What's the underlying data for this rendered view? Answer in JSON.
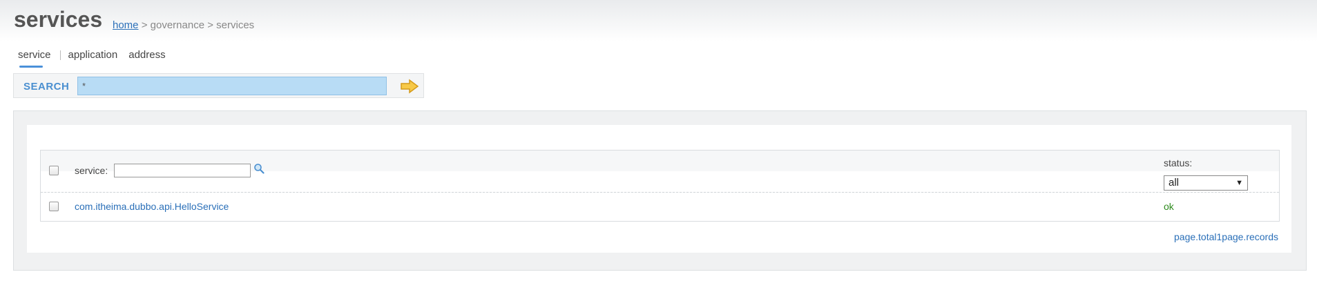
{
  "header": {
    "title": "services",
    "breadcrumb": {
      "home": "home",
      "sep1": " > ",
      "governance": "governance",
      "sep2": " > ",
      "current": "services"
    }
  },
  "tabs": [
    {
      "label": "service",
      "active": true
    },
    {
      "label": "application",
      "active": false
    },
    {
      "label": "address",
      "active": false
    }
  ],
  "search": {
    "label": "SEARCH",
    "value": "*",
    "go_icon": "arrow-right-icon"
  },
  "table": {
    "columns": {
      "service_label": "service:",
      "status_label": "status:"
    },
    "service_filter": {
      "value": "",
      "icon": "magnifier-icon"
    },
    "status_select": {
      "selected": "all"
    },
    "rows": [
      {
        "service": "com.itheima.dubbo.api.HelloService",
        "status": "ok"
      }
    ]
  },
  "paging": {
    "text": "page.total1page.records"
  },
  "colors": {
    "accent": "#4a8fd0",
    "link": "#2a6fb8",
    "ok": "#2e8b1e",
    "search_field": "#b8dcf5"
  }
}
